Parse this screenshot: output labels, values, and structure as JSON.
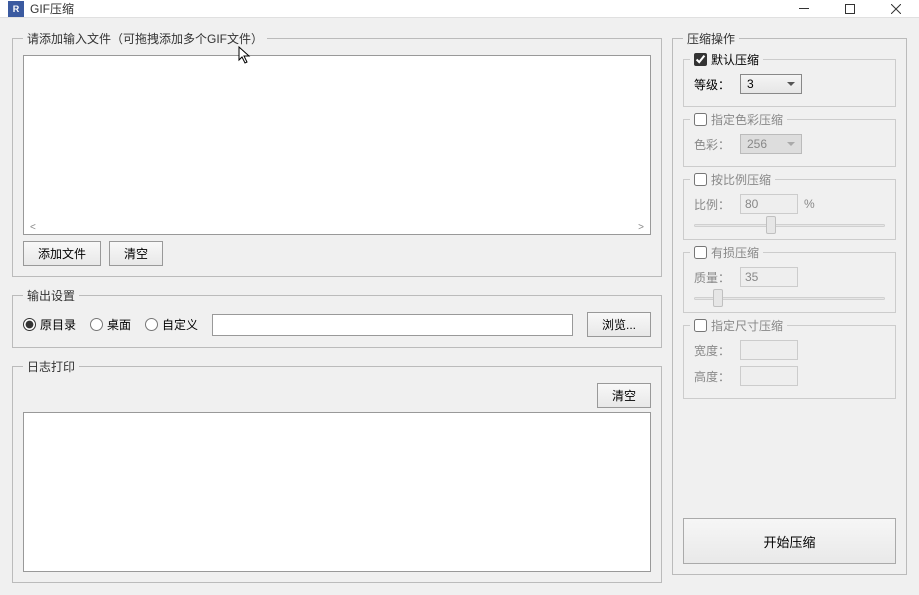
{
  "title": "GIF压缩",
  "input_section": {
    "legend": "请添加输入文件（可拖拽添加多个GIF文件）",
    "add_btn": "添加文件",
    "clear_btn": "清空"
  },
  "output_section": {
    "legend": "输出设置",
    "opt_original": "原目录",
    "opt_desktop": "桌面",
    "opt_custom": "自定义",
    "path": "",
    "browse_btn": "浏览..."
  },
  "log_section": {
    "legend": "日志打印",
    "clear_btn": "清空"
  },
  "compress_section": {
    "legend": "压缩操作",
    "default": {
      "title": "默认压缩",
      "checked": true,
      "level_label": "等级：",
      "level_value": "3"
    },
    "color": {
      "title": "指定色彩压缩",
      "checked": false,
      "color_label": "色彩：",
      "color_value": "256"
    },
    "ratio": {
      "title": "按比例压缩",
      "checked": false,
      "ratio_label": "比例：",
      "ratio_value": "80",
      "unit": "%"
    },
    "lossy": {
      "title": "有损压缩",
      "checked": false,
      "quality_label": "质量：",
      "quality_value": "35"
    },
    "size": {
      "title": "指定尺寸压缩",
      "checked": false,
      "width_label": "宽度：",
      "height_label": "高度：",
      "width_value": "",
      "height_value": ""
    },
    "start_btn": "开始压缩"
  }
}
